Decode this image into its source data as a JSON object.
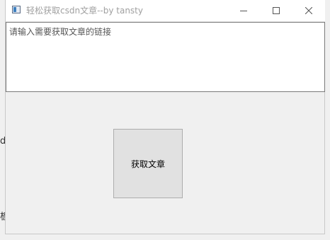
{
  "window": {
    "title": "轻松获取csdn文章--by tansty"
  },
  "icons": {
    "app": "app-window-icon",
    "minimize": "minimize-icon",
    "maximize": "maximize-icon",
    "close": "close-icon"
  },
  "input": {
    "placeholder": "请输入需要获取文章的链接",
    "value": ""
  },
  "button": {
    "label": "获取文章"
  },
  "background": {
    "fragment_1": "d",
    "fragment_2": "板"
  }
}
